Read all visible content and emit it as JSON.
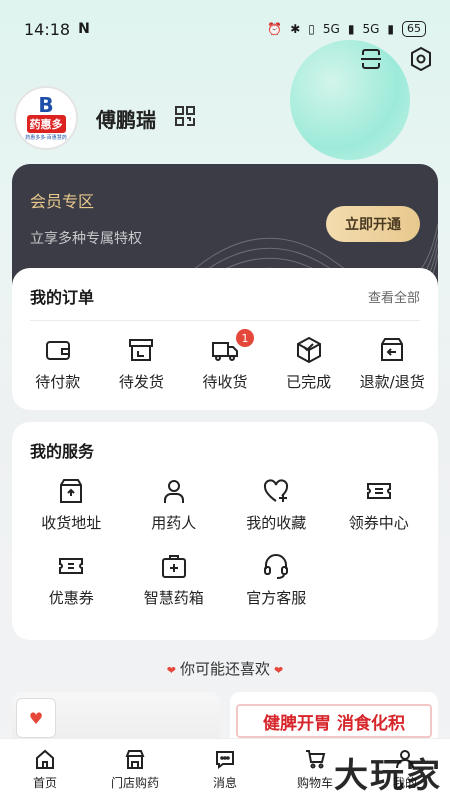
{
  "status_bar": {
    "time": "14:18",
    "nfc": "N",
    "signal1": "5G",
    "signal2": "5G",
    "battery": "65"
  },
  "profile": {
    "username": "傅鹏瑞",
    "avatar_logo_b": "B",
    "avatar_logo_text": "药惠多",
    "avatar_logo_sub": "药惠多多·百惠慧药"
  },
  "member": {
    "title": "会员专区",
    "subtitle": "立享多种专属特权",
    "button": "立即开通"
  },
  "orders": {
    "title": "我的订单",
    "view_all": "查看全部",
    "items": [
      {
        "label": "待付款",
        "icon": "wallet-icon"
      },
      {
        "label": "待发货",
        "icon": "box-icon"
      },
      {
        "label": "待收货",
        "icon": "truck-icon",
        "badge": "1"
      },
      {
        "label": "已完成",
        "icon": "package-check-icon"
      },
      {
        "label": "退款/退货",
        "icon": "return-box-icon"
      }
    ]
  },
  "services": {
    "title": "我的服务",
    "items": [
      {
        "label": "收货地址",
        "icon": "address-box-icon"
      },
      {
        "label": "用药人",
        "icon": "person-icon"
      },
      {
        "label": "我的收藏",
        "icon": "heart-plus-icon"
      },
      {
        "label": "领券中心",
        "icon": "coupon-center-icon"
      },
      {
        "label": "优惠券",
        "icon": "coupon-icon"
      },
      {
        "label": "智慧药箱",
        "icon": "medkit-icon"
      },
      {
        "label": "官方客服",
        "icon": "headset-icon"
      }
    ]
  },
  "recommend": {
    "title": "你可能还喜欢",
    "promo_text": "健脾开胃 消食化积"
  },
  "tabbar": [
    {
      "label": "首页",
      "icon": "home-icon"
    },
    {
      "label": "门店购药",
      "icon": "store-icon"
    },
    {
      "label": "消息",
      "icon": "message-icon"
    },
    {
      "label": "购物车",
      "icon": "cart-icon"
    },
    {
      "label": "我的",
      "icon": "user-icon"
    }
  ],
  "watermark": "大玩家",
  "colors": {
    "accent_gold": "#e9c98c",
    "badge_red": "#e5473a",
    "member_bg": "#3c3c46"
  }
}
